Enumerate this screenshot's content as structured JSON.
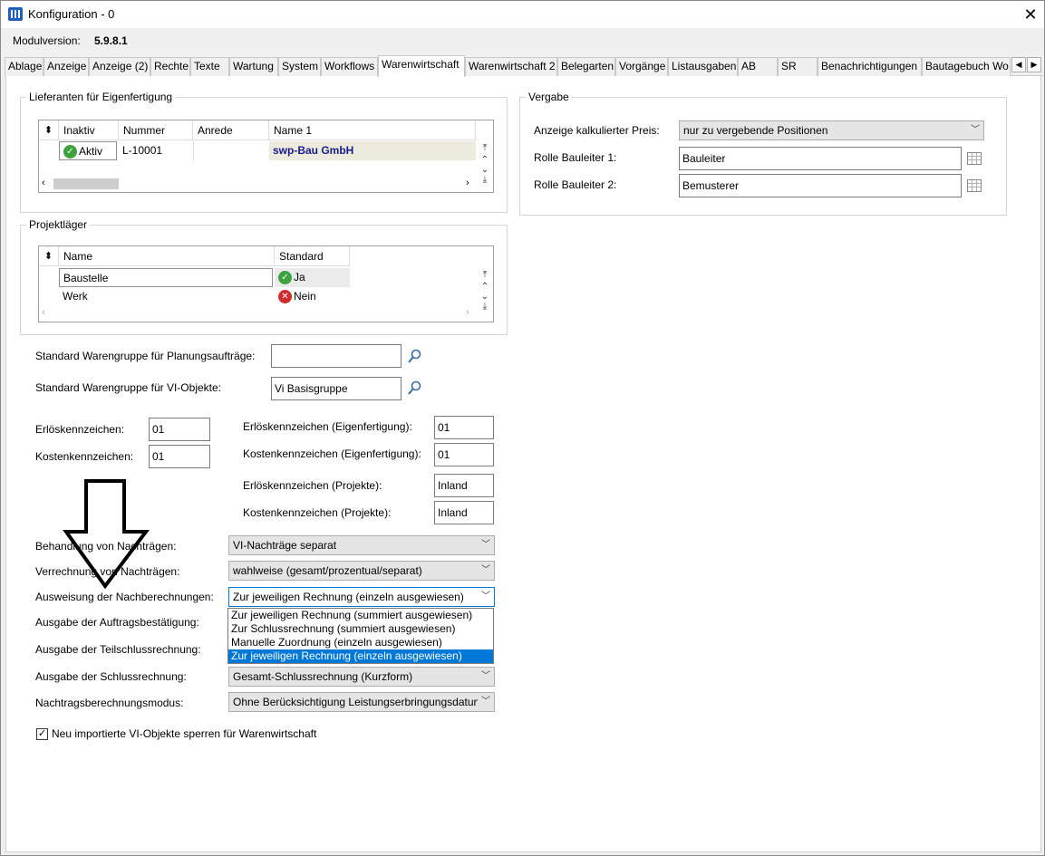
{
  "window": {
    "title": "Konfiguration - 0",
    "close": "✕"
  },
  "modul": {
    "label": "Modulversion:",
    "value": "5.9.8.1"
  },
  "tabs": [
    "Ablage",
    "Anzeige",
    "Anzeige (2)",
    "Rechte",
    "Texte",
    "Wartung",
    "System",
    "Workflows",
    "Warenwirtschaft",
    "Warenwirtschaft 2",
    "Belegarten",
    "Vorgänge",
    "Listausgaben",
    "AB",
    "SR",
    "Benachrichtigungen",
    "Bautagebuch Wo"
  ],
  "active_tab": "Warenwirtschaft",
  "lieferanten": {
    "title": "Lieferanten für Eigenfertigung",
    "columns": [
      "Inaktiv",
      "Nummer",
      "Anrede",
      "Name 1"
    ],
    "row": {
      "inaktiv": "Aktiv",
      "nummer": "L-10001",
      "anrede": "",
      "name": "swp-Bau GmbH"
    }
  },
  "projektlaeger": {
    "title": "Projektläger",
    "columns": [
      "Name",
      "Standard"
    ],
    "rows": [
      {
        "name": "Baustelle",
        "standard": "Ja"
      },
      {
        "name": "Werk",
        "standard": "Nein"
      }
    ]
  },
  "vergabe": {
    "title": "Vergabe",
    "preis_label": "Anzeige kalkulierter Preis:",
    "preis_value": "nur zu vergebende Positionen",
    "rolle1_label": "Rolle Bauleiter 1:",
    "rolle1_value": "Bauleiter",
    "rolle2_label": "Rolle Bauleiter 2:",
    "rolle2_value": "Bemusterer"
  },
  "warengruppe": {
    "planung_label": "Standard Warengruppe für Planungsaufträge:",
    "planung_value": "",
    "vi_label": "Standard Warengruppe für VI-Objekte:",
    "vi_value": "Vi Basisgruppe"
  },
  "kennzeichen": {
    "erloes_label": "Erlöskennzeichen:",
    "erloes_value": "01",
    "kosten_label": "Kostenkennzeichen:",
    "kosten_value": "01",
    "erloes_eigen_label": "Erlöskennzeichen (Eigenfertigung):",
    "erloes_eigen_value": "01",
    "kosten_eigen_label": "Kostenkennzeichen (Eigenfertigung):",
    "kosten_eigen_value": "01",
    "erloes_proj_label": "Erlöskennzeichen (Projekte):",
    "erloes_proj_value": "Inland",
    "kosten_proj_label": "Kostenkennzeichen (Projekte):",
    "kosten_proj_value": "Inland"
  },
  "settings": {
    "behandlung_label": "Behandlung von Nachträgen:",
    "behandlung_value": "VI-Nachträge separat",
    "verrechnung_label": "Verrechnung von Nachträgen:",
    "verrechnung_value": "wahlweise (gesamt/prozentual/separat)",
    "ausweisung_label": "Ausweisung der Nachberechnungen:",
    "ausweisung_value": "Zur jeweiligen Rechnung (einzeln ausgewiesen)",
    "auftrag_label": "Ausgabe der Auftragsbestätigung:",
    "teilschluss_label": "Ausgabe der Teilschlussrechnung:",
    "schluss_label": "Ausgabe der Schlussrechnung:",
    "schluss_value": "Gesamt-Schlussrechnung (Kurzform)",
    "modus_label": "Nachtragsberechnungsmodus:",
    "modus_value": "Ohne Berücksichtigung Leistungserbringungsdatum"
  },
  "dropdown_options": [
    "Zur jeweiligen Rechnung (summiert ausgewiesen)",
    "Zur Schlussrechnung (summiert ausgewiesen)",
    "Manuelle Zuordnung (einzeln ausgewiesen)",
    "Zur jeweiligen Rechnung (einzeln ausgewiesen)"
  ],
  "checkbox": {
    "label": "Neu importierte VI-Objekte sperren für Warenwirtschaft",
    "checked": true
  },
  "colors": {
    "accent": "#0078d7",
    "name_highlight": "#1b1b8a",
    "row_highlight": "#ecebdd"
  }
}
